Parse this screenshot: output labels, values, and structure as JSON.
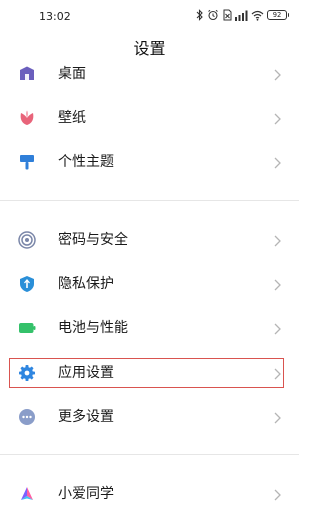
{
  "status_bar": {
    "time": "13:02",
    "battery": "92"
  },
  "header": {
    "title": "设置"
  },
  "settings": {
    "items": [
      {
        "label": "桌面"
      },
      {
        "label": "壁纸"
      },
      {
        "label": "个性主题"
      },
      {
        "label": "密码与安全"
      },
      {
        "label": "隐私保护"
      },
      {
        "label": "电池与性能"
      },
      {
        "label": "应用设置"
      },
      {
        "label": "更多设置"
      },
      {
        "label": "小爱同学"
      }
    ]
  },
  "colors": {
    "highlight_border": "#d9534f",
    "desktop_icon": "#6b5fbd",
    "wallpaper_icon": "#e8647a",
    "theme_icon": "#2f7fd9",
    "security_icon": "#7a86a8",
    "privacy_icon": "#2a8fd8",
    "battery_icon": "#34c16a",
    "app_settings_icon": "#2f86e0",
    "more_settings_icon": "#8a9dc9"
  },
  "icons": [
    "desktop-icon",
    "wallpaper-icon",
    "theme-icon",
    "security-icon",
    "privacy-icon",
    "battery-icon",
    "app-settings-icon",
    "more-settings-icon",
    "xiaoai-icon"
  ]
}
